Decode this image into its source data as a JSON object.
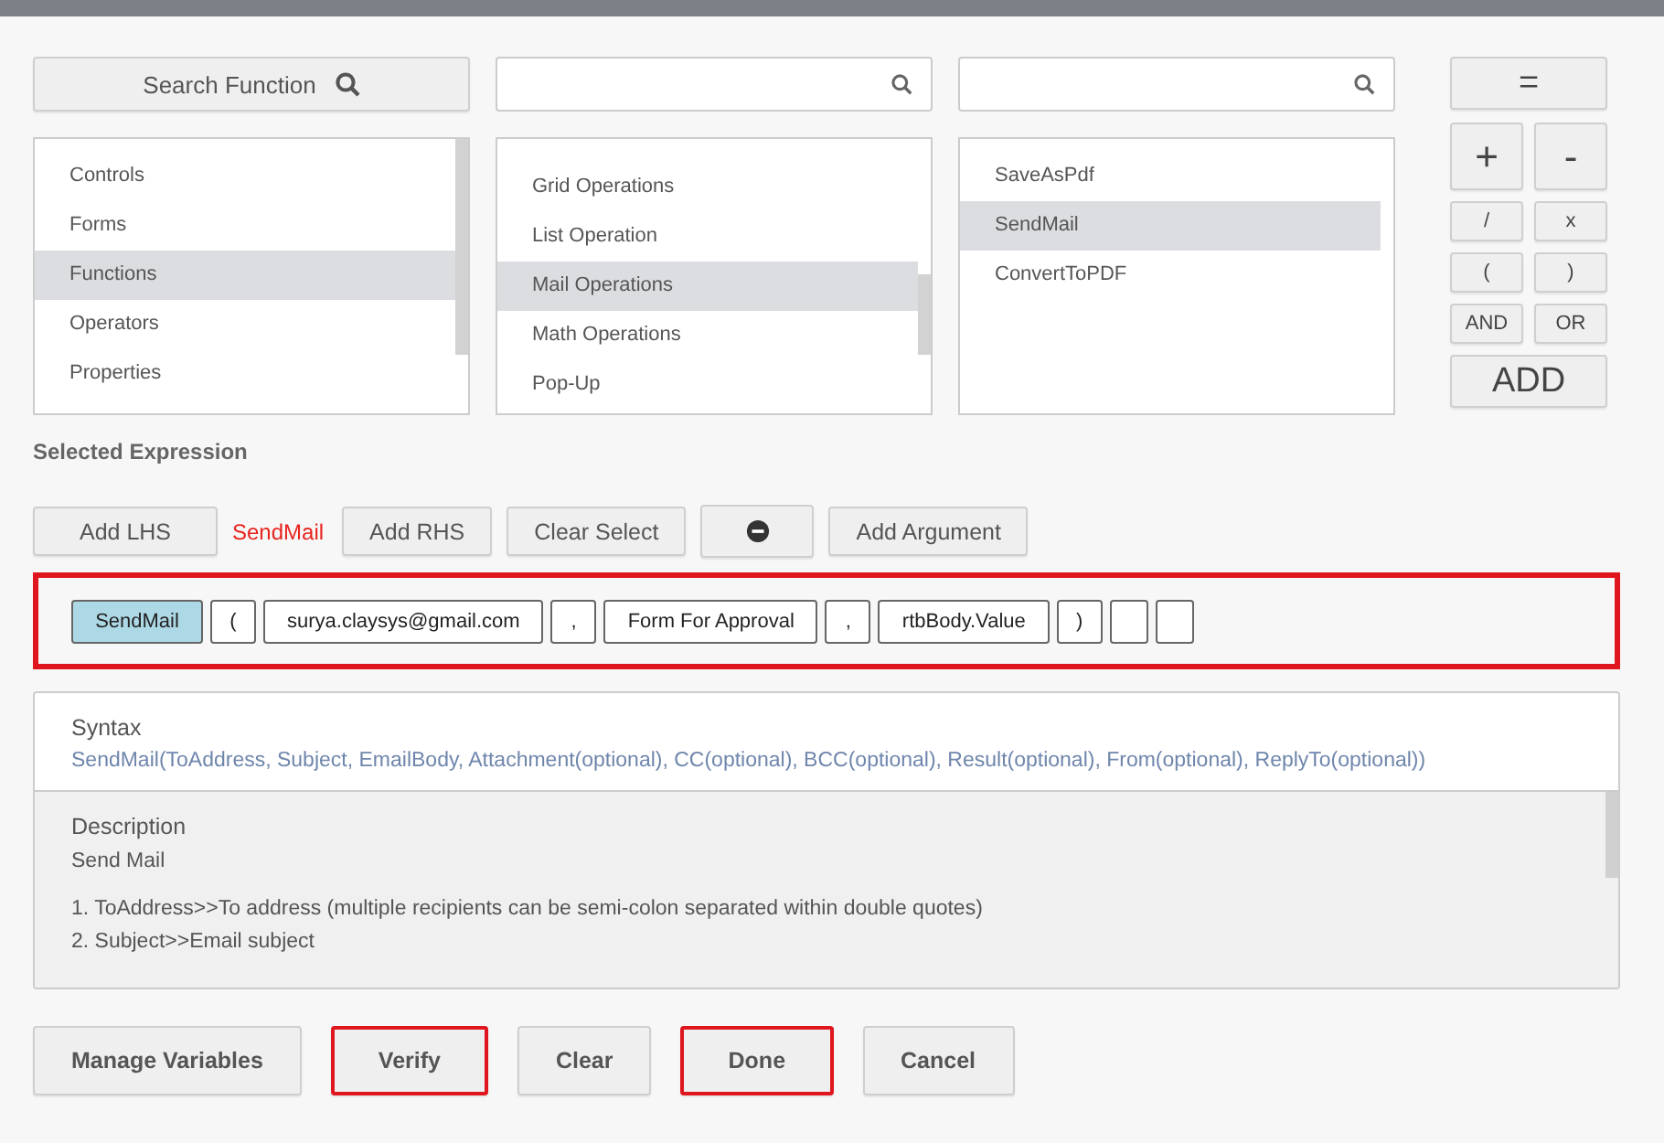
{
  "search_function": {
    "label": "Search Function"
  },
  "category_list": {
    "items": [
      {
        "label": "Controls",
        "selected": false
      },
      {
        "label": "Forms",
        "selected": false
      },
      {
        "label": "Functions",
        "selected": true
      },
      {
        "label": "Operators",
        "selected": false
      },
      {
        "label": "Properties",
        "selected": false
      }
    ]
  },
  "group_list": {
    "items": [
      {
        "label": "Grid Operations",
        "selected": false
      },
      {
        "label": "List Operation",
        "selected": false
      },
      {
        "label": "Mail Operations",
        "selected": true
      },
      {
        "label": "Math Operations",
        "selected": false
      },
      {
        "label": "Pop-Up",
        "selected": false
      }
    ]
  },
  "function_list": {
    "items": [
      {
        "label": "SaveAsPdf",
        "selected": false
      },
      {
        "label": "SendMail",
        "selected": true
      },
      {
        "label": "ConvertToPDF",
        "selected": false
      }
    ]
  },
  "operators": [
    {
      "label": "=",
      "kind": "wide"
    },
    {
      "label": "+",
      "kind": "big"
    },
    {
      "label": "-",
      "kind": "big"
    },
    {
      "label": "/",
      "kind": "small"
    },
    {
      "label": "x",
      "kind": "small"
    },
    {
      "label": "(",
      "kind": "small"
    },
    {
      "label": ")",
      "kind": "small"
    },
    {
      "label": "AND",
      "kind": "small"
    },
    {
      "label": "OR",
      "kind": "small"
    },
    {
      "label": "ADD",
      "kind": "wide"
    }
  ],
  "selected_expression": {
    "title": "Selected Expression",
    "current": "SendMail"
  },
  "expression_buttons": [
    {
      "label": "Add LHS",
      "kind": "text"
    },
    {
      "label": "Add RHS",
      "kind": "text"
    },
    {
      "label": "Clear Select",
      "kind": "text"
    },
    {
      "kind": "remove"
    },
    {
      "label": "Add Argument",
      "kind": "text"
    }
  ],
  "tokens": [
    {
      "kind": "function",
      "label": "SendMail"
    },
    {
      "kind": "symbol",
      "label": "("
    },
    {
      "kind": "value",
      "label": "surya.claysys@gmail.com"
    },
    {
      "kind": "symbol",
      "label": ","
    },
    {
      "kind": "value",
      "label": "Form For Approval"
    },
    {
      "kind": "symbol",
      "label": ","
    },
    {
      "kind": "value",
      "label": "rtbBody.Value"
    },
    {
      "kind": "symbol",
      "label": ")"
    },
    {
      "kind": "empty"
    },
    {
      "kind": "empty"
    }
  ],
  "syntax": {
    "title": "Syntax",
    "text": "SendMail(ToAddress, Subject, EmailBody, Attachment(optional), CC(optional), BCC(optional), Result(optional), From(optional), ReplyTo(optional))"
  },
  "description": {
    "title": "Description",
    "summary": "Send Mail",
    "lines": [
      "1. ToAddress>>To address (multiple recipients can be semi-colon separated within double quotes)",
      "2. Subject>>Email subject"
    ]
  },
  "footer_buttons": [
    {
      "label": "Manage Variables",
      "highlighted": false
    },
    {
      "label": "Verify",
      "highlighted": true
    },
    {
      "label": "Clear",
      "highlighted": false
    },
    {
      "label": "Done",
      "highlighted": true
    },
    {
      "label": "Cancel",
      "highlighted": false
    }
  ]
}
